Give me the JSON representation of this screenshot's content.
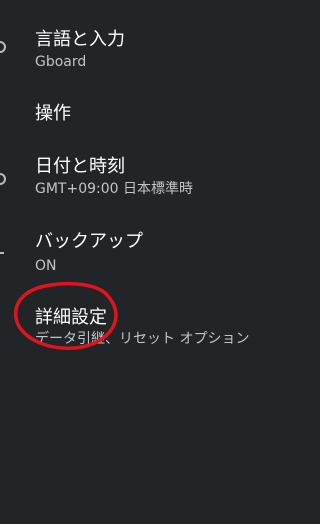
{
  "settings": {
    "items": [
      {
        "title": "言語と入力",
        "subtitle": "Gboard",
        "icon": "globe-icon"
      },
      {
        "title": "操作",
        "subtitle": "",
        "icon": ""
      },
      {
        "title": "日付と時刻",
        "subtitle": "GMT+09:00 日本標準時",
        "icon": "clock-icon"
      },
      {
        "title": "バックアップ",
        "subtitle": "ON",
        "icon": "backup-icon"
      },
      {
        "title": "詳細設定",
        "subtitle": "データ引継、リセット オプション",
        "icon": ""
      }
    ]
  },
  "annotation": {
    "color": "#e0141e"
  }
}
